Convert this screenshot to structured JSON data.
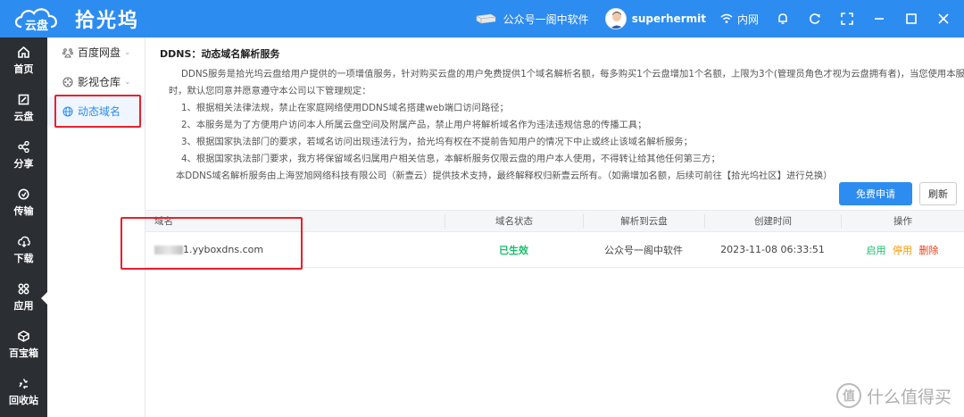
{
  "app": {
    "brand_badge": "云盘",
    "name": "拾光坞"
  },
  "topbar": {
    "device_name": "公众号一阁中软件",
    "username": "superhermit",
    "network": "内网"
  },
  "sidebar": {
    "items": [
      {
        "label": "首页",
        "icon": "home-icon"
      },
      {
        "label": "云盘",
        "icon": "cloud-drive-icon"
      },
      {
        "label": "分享",
        "icon": "share-icon"
      },
      {
        "label": "传输",
        "icon": "transfer-icon"
      },
      {
        "label": "下载",
        "icon": "download-icon"
      },
      {
        "label": "应用",
        "icon": "apps-icon"
      },
      {
        "label": "百宝箱",
        "icon": "toolbox-icon"
      },
      {
        "label": "回收站",
        "icon": "recycle-icon"
      }
    ],
    "active": "应用"
  },
  "submenu": {
    "items": [
      {
        "label": "百度网盘",
        "icon": "baidu-icon",
        "expandable": true
      },
      {
        "label": "影视仓库",
        "icon": "film-icon",
        "expandable": true
      },
      {
        "label": "动态域名",
        "icon": "globe-icon",
        "expandable": false
      }
    ],
    "active": "动态域名"
  },
  "ddns": {
    "title": "DDNS：动态域名解析服务",
    "intro1": "DDNS服务是拾光坞云盘给用户提供的一项增值服务，针对购买云盘的用户免费提供1个域名解析名额，每多购买1个云盘增加1个名额，上限为3个(管理员角色才视为云盘拥有者)，当您使用本服务",
    "intro2": "时，默认您同意并愿意遵守本公司以下管理规定：",
    "rules": [
      "1、根据相关法律法规，禁止在家庭网络使用DDNS域名搭建web端口访问路径；",
      "2、本服务是为了方便用户访问本人所属云盘空间及附属产品，禁止用户将解析域名作为违法违规信息的传播工具；",
      "3、根据国家执法部门的要求，若域名访问出现违法行为，拾光坞有权在不提前告知用户的情况下中止或终止该域名解析服务；",
      "4、根据国家执法部门要求，我方将保留域名归属用户相关信息，本解析服务仅限云盘的用户本人使用，不得转让给其他任何第三方；"
    ],
    "footer": "本DDNS域名解析服务由上海翌旭网络科技有限公司（新壹云）提供技术支持，最终解释权归新壹云所有。（如需增加名额，后续可前往【拾光坞社区】进行兑换）",
    "apply_label": "免费申请",
    "refresh_label": "刷新"
  },
  "table": {
    "headers": [
      "域名",
      "域名状态",
      "解析到云盘",
      "创建时间",
      "操作"
    ],
    "rows": [
      {
        "domain": "1.yyboxdns.com",
        "status": "已生效",
        "target": "公众号一阁中软件",
        "created": "2023-11-08 06:33:51",
        "actions": [
          "启用",
          "停用",
          "删除"
        ]
      }
    ]
  },
  "watermark": {
    "badge": "值",
    "text": "什么值得买"
  },
  "colors": {
    "primary": "#2d8cf0",
    "sidebar_bg": "#2b2e33",
    "success": "#19be6b",
    "warning": "#ff9900",
    "danger": "#ed3f14",
    "highlight_box": "#e8202a"
  }
}
